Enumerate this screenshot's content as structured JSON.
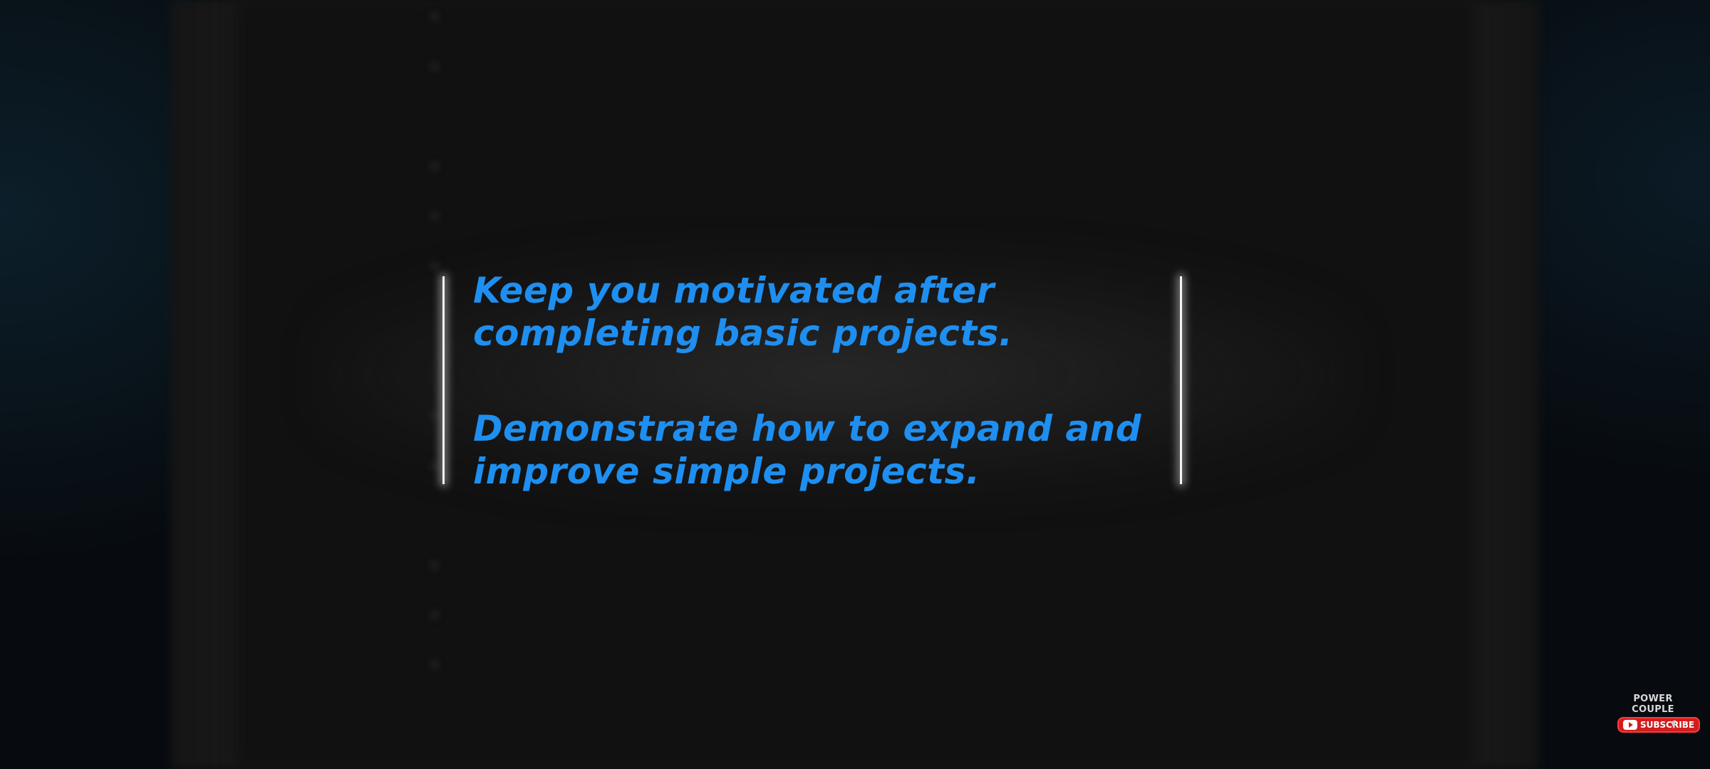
{
  "overlay": {
    "line1": "Keep you motivated after completing basic projects.",
    "line2": "Demonstrate how to expand and improve simple projects."
  },
  "watermark": {
    "channel": "POWER COUPLE",
    "subscribe": "SUBSCRIBE",
    "icon": "youtube-icon"
  },
  "colors": {
    "overlay_text": "#1e8ff0",
    "subscribe_bg": "#d21d1d",
    "divider": "#f4f4f4"
  }
}
